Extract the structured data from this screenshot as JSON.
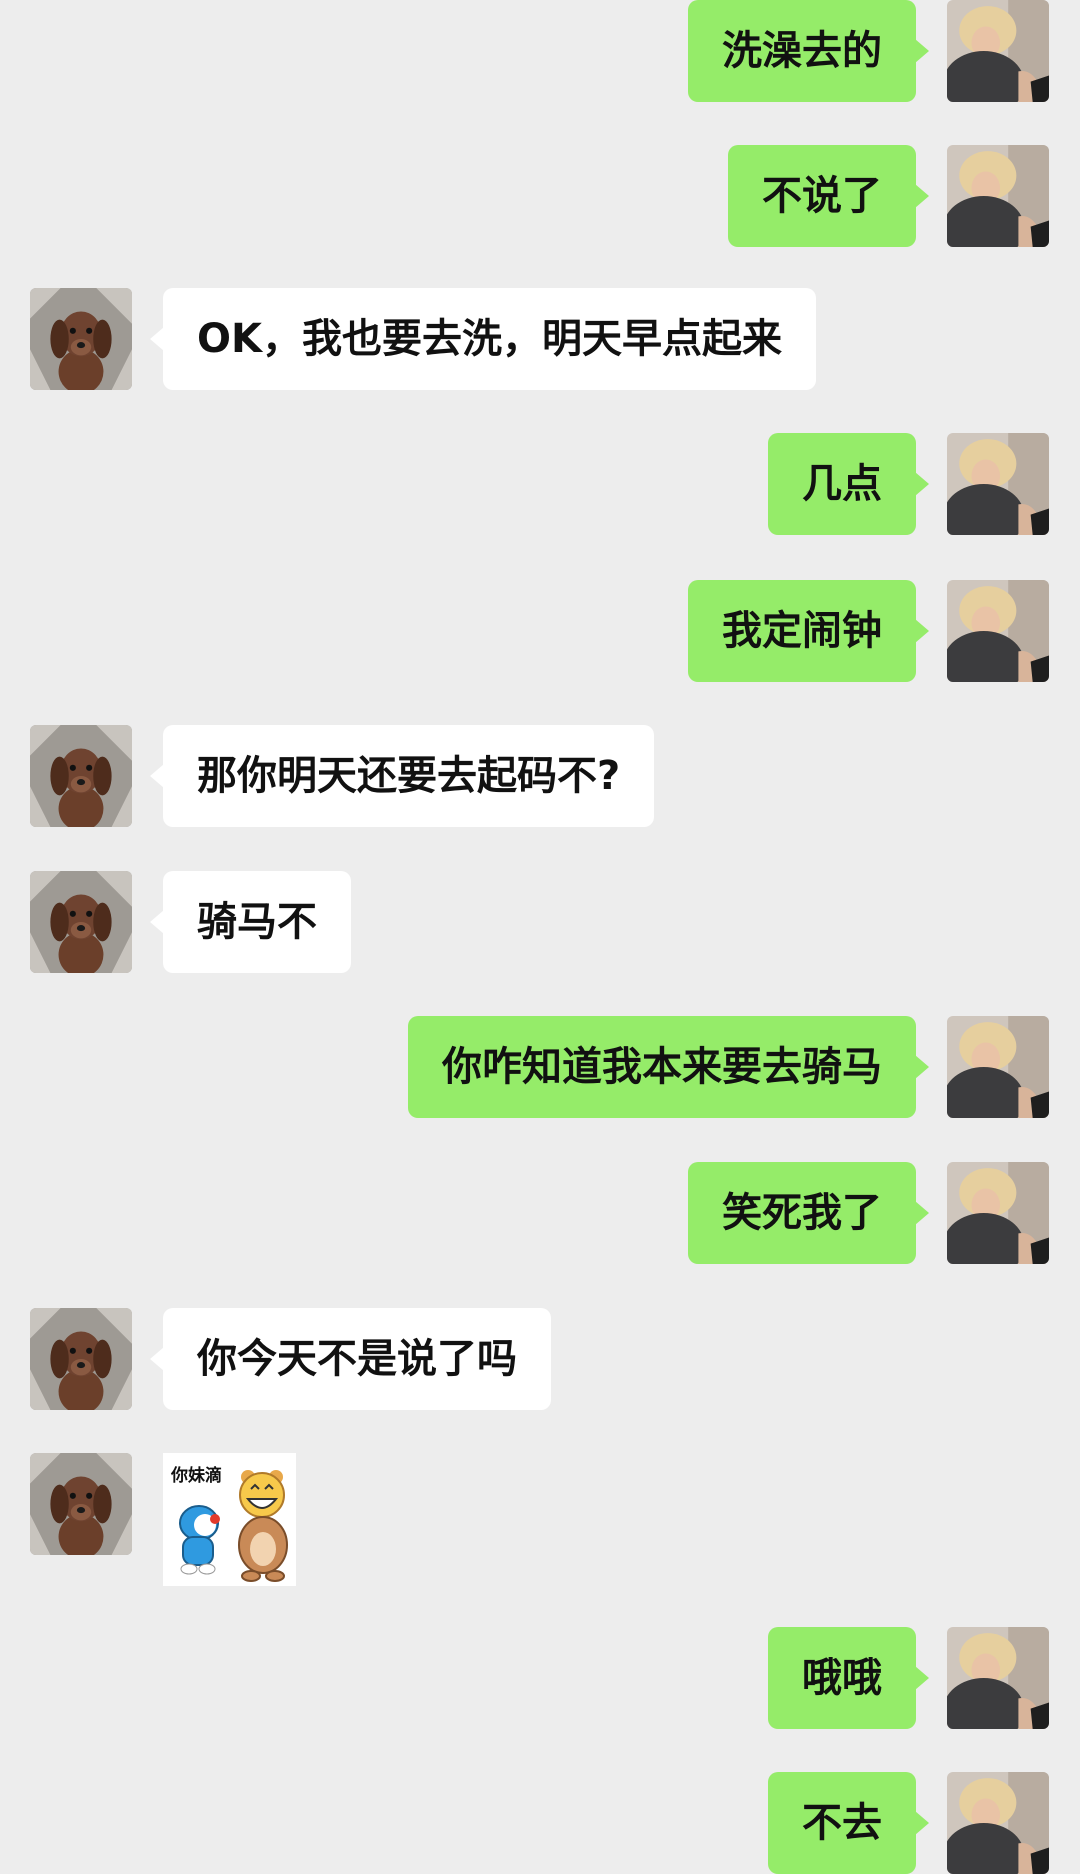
{
  "messages": [
    {
      "side": "self",
      "text": "洗澡去的"
    },
    {
      "side": "self",
      "text": "不说了"
    },
    {
      "side": "other",
      "text": "OK，我也要去洗，明天早点起来"
    },
    {
      "side": "self",
      "text": "几点"
    },
    {
      "side": "self",
      "text": "我定闹钟"
    },
    {
      "side": "other",
      "text": "那你明天还要去起码不?"
    },
    {
      "side": "other",
      "text": "骑马不"
    },
    {
      "side": "self",
      "text": "你咋知道我本来要去骑马"
    },
    {
      "side": "self",
      "text": "笑死我了"
    },
    {
      "side": "other",
      "text": "你今天不是说了吗"
    },
    {
      "side": "other",
      "sticker": true,
      "sticker_text": "你妹滴",
      "icon": "doraemon-and-bear-laughing-sticker"
    },
    {
      "side": "self",
      "text": "哦哦"
    },
    {
      "side": "self",
      "text": "不去"
    }
  ],
  "avatars": {
    "self": {
      "icon": "blonde-woman-avatar"
    },
    "other": {
      "icon": "dachshund-puppy-avatar"
    }
  },
  "colors": {
    "background": "#ededed",
    "self_bubble": "#95ec69",
    "other_bubble": "#ffffff"
  }
}
